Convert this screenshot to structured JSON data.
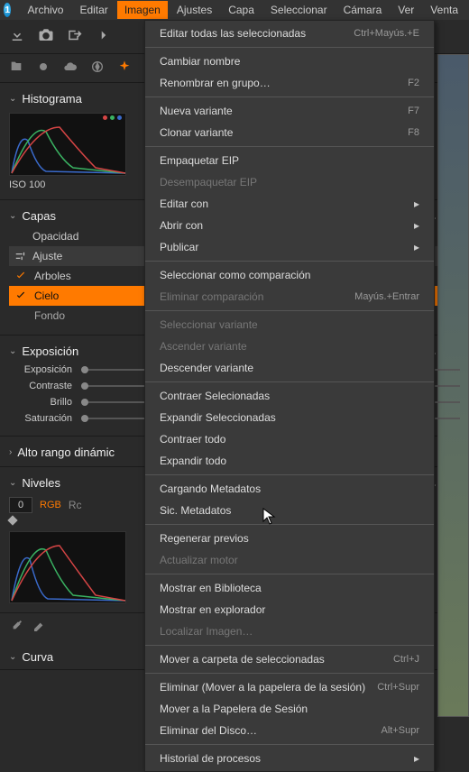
{
  "menubar": {
    "items": [
      "Archivo",
      "Editar",
      "Imagen",
      "Ajustes",
      "Capa",
      "Seleccionar",
      "Cámara",
      "Ver",
      "Venta"
    ],
    "active_index": 2
  },
  "dropdown": {
    "groups": [
      [
        {
          "label": "Editar todas las seleccionadas",
          "shortcut": "Ctrl+Mayús.+E",
          "enabled": true
        }
      ],
      [
        {
          "label": "Cambiar nombre",
          "shortcut": "",
          "enabled": true
        },
        {
          "label": "Renombrar en grupo…",
          "shortcut": "F2",
          "enabled": true
        }
      ],
      [
        {
          "label": "Nueva variante",
          "shortcut": "F7",
          "enabled": true
        },
        {
          "label": "Clonar variante",
          "shortcut": "F8",
          "enabled": true
        }
      ],
      [
        {
          "label": "Empaquetar EIP",
          "shortcut": "",
          "enabled": true
        },
        {
          "label": "Desempaquetar EIP",
          "shortcut": "",
          "enabled": false
        },
        {
          "label": "Editar con",
          "shortcut": "",
          "enabled": true,
          "submenu": true
        },
        {
          "label": "Abrir con",
          "shortcut": "",
          "enabled": true,
          "submenu": true
        },
        {
          "label": "Publicar",
          "shortcut": "",
          "enabled": true,
          "submenu": true
        }
      ],
      [
        {
          "label": "Seleccionar como comparación",
          "shortcut": "",
          "enabled": true
        },
        {
          "label": "Eliminar comparación",
          "shortcut": "Mayús.+Entrar",
          "enabled": false
        }
      ],
      [
        {
          "label": "Seleccionar variante",
          "shortcut": "",
          "enabled": false
        },
        {
          "label": "Ascender variante",
          "shortcut": "",
          "enabled": false
        },
        {
          "label": "Descender variante",
          "shortcut": "",
          "enabled": true
        }
      ],
      [
        {
          "label": "Contraer Selecionadas",
          "shortcut": "",
          "enabled": true
        },
        {
          "label": "Expandir Seleccionadas",
          "shortcut": "",
          "enabled": true
        },
        {
          "label": "Contraer todo",
          "shortcut": "",
          "enabled": true
        },
        {
          "label": "Expandir todo",
          "shortcut": "",
          "enabled": true
        }
      ],
      [
        {
          "label": "Cargando Metadatos",
          "shortcut": "",
          "enabled": true
        },
        {
          "label": "Sic. Metadatos",
          "shortcut": "",
          "enabled": true
        }
      ],
      [
        {
          "label": "Regenerar previos",
          "shortcut": "",
          "enabled": true
        },
        {
          "label": "Actualizar motor",
          "shortcut": "",
          "enabled": false
        }
      ],
      [
        {
          "label": "Mostrar en Biblioteca",
          "shortcut": "",
          "enabled": true
        },
        {
          "label": "Mostrar en explorador",
          "shortcut": "",
          "enabled": true
        },
        {
          "label": "Localizar Imagen…",
          "shortcut": "",
          "enabled": false
        }
      ],
      [
        {
          "label": "Mover a carpeta de seleccionadas",
          "shortcut": "Ctrl+J",
          "enabled": true
        }
      ],
      [
        {
          "label": "Eliminar (Mover a la papelera de la sesión)",
          "shortcut": "Ctrl+Supr",
          "enabled": true
        },
        {
          "label": "Mover a la Papelera de Sesión",
          "shortcut": "",
          "enabled": true
        },
        {
          "label": "Eliminar del Disco…",
          "shortcut": "Alt+Supr",
          "enabled": true
        }
      ],
      [
        {
          "label": "Historial de procesos",
          "shortcut": "",
          "enabled": true,
          "submenu": true
        }
      ]
    ]
  },
  "histogram": {
    "title": "Histograma",
    "iso": "ISO 100"
  },
  "layers": {
    "title": "Capas",
    "rows": [
      "Opacidad",
      "Ajuste"
    ],
    "items": [
      {
        "name": "Arboles",
        "checked": true,
        "selected": false
      },
      {
        "name": "Cielo",
        "checked": true,
        "selected": true
      },
      {
        "name": "Fondo",
        "checked": false,
        "selected": false
      }
    ]
  },
  "exposure": {
    "title": "Exposición",
    "sliders": [
      "Exposición",
      "Contraste",
      "Brillo",
      "Saturación"
    ]
  },
  "hdr": {
    "title": "Alto rango dinámic"
  },
  "levels": {
    "title": "Niveles",
    "value": "0",
    "channel": "RGB",
    "extra": "Rc"
  },
  "curve": {
    "title": "Curva"
  }
}
